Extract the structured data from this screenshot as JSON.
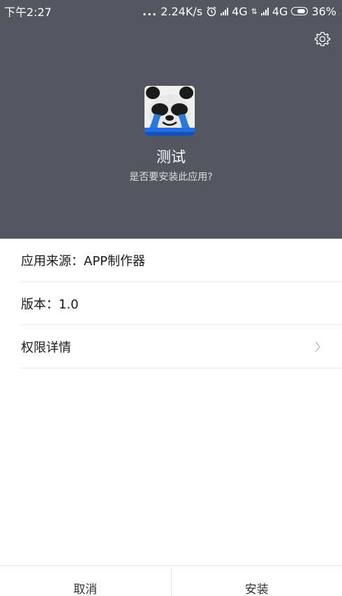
{
  "status_bar": {
    "time": "下午2:27",
    "dots": "...",
    "speed": "2.24K/s",
    "network1": "4G",
    "network1_arrows": "⇅",
    "network2": "4G",
    "battery": "36%",
    "icons": [
      "alarm-icon",
      "signal-icon",
      "battery-icon"
    ]
  },
  "header": {
    "bg_color": "#555760",
    "settings_icon": "gear-icon",
    "app_name": "测试",
    "question": "是否要安装此应用?"
  },
  "details": {
    "source": "应用来源：APP制作器",
    "version": "版本：1.0",
    "permissions": "权限详情"
  },
  "footer": {
    "cancel_label": "取消",
    "install_label": "安装"
  }
}
